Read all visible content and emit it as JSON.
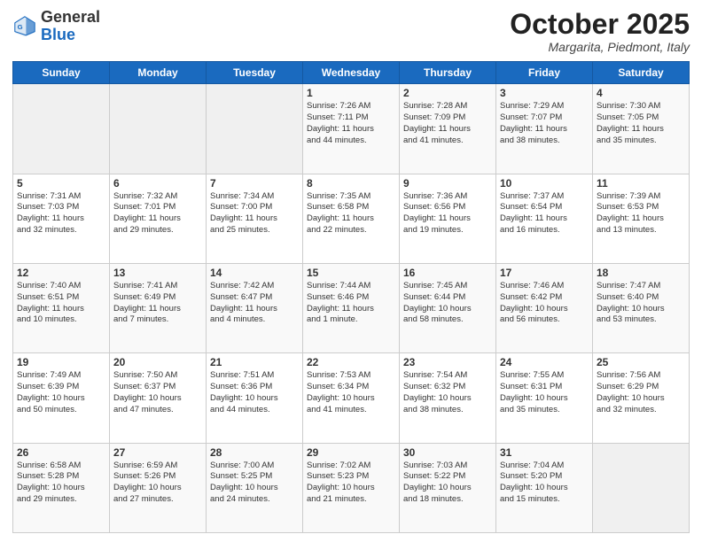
{
  "header": {
    "logo_general": "General",
    "logo_blue": "Blue",
    "month_title": "October 2025",
    "location": "Margarita, Piedmont, Italy"
  },
  "days_of_week": [
    "Sunday",
    "Monday",
    "Tuesday",
    "Wednesday",
    "Thursday",
    "Friday",
    "Saturday"
  ],
  "weeks": [
    [
      {
        "day": "",
        "info": ""
      },
      {
        "day": "",
        "info": ""
      },
      {
        "day": "",
        "info": ""
      },
      {
        "day": "1",
        "info": "Sunrise: 7:26 AM\nSunset: 7:11 PM\nDaylight: 11 hours\nand 44 minutes."
      },
      {
        "day": "2",
        "info": "Sunrise: 7:28 AM\nSunset: 7:09 PM\nDaylight: 11 hours\nand 41 minutes."
      },
      {
        "day": "3",
        "info": "Sunrise: 7:29 AM\nSunset: 7:07 PM\nDaylight: 11 hours\nand 38 minutes."
      },
      {
        "day": "4",
        "info": "Sunrise: 7:30 AM\nSunset: 7:05 PM\nDaylight: 11 hours\nand 35 minutes."
      }
    ],
    [
      {
        "day": "5",
        "info": "Sunrise: 7:31 AM\nSunset: 7:03 PM\nDaylight: 11 hours\nand 32 minutes."
      },
      {
        "day": "6",
        "info": "Sunrise: 7:32 AM\nSunset: 7:01 PM\nDaylight: 11 hours\nand 29 minutes."
      },
      {
        "day": "7",
        "info": "Sunrise: 7:34 AM\nSunset: 7:00 PM\nDaylight: 11 hours\nand 25 minutes."
      },
      {
        "day": "8",
        "info": "Sunrise: 7:35 AM\nSunset: 6:58 PM\nDaylight: 11 hours\nand 22 minutes."
      },
      {
        "day": "9",
        "info": "Sunrise: 7:36 AM\nSunset: 6:56 PM\nDaylight: 11 hours\nand 19 minutes."
      },
      {
        "day": "10",
        "info": "Sunrise: 7:37 AM\nSunset: 6:54 PM\nDaylight: 11 hours\nand 16 minutes."
      },
      {
        "day": "11",
        "info": "Sunrise: 7:39 AM\nSunset: 6:53 PM\nDaylight: 11 hours\nand 13 minutes."
      }
    ],
    [
      {
        "day": "12",
        "info": "Sunrise: 7:40 AM\nSunset: 6:51 PM\nDaylight: 11 hours\nand 10 minutes."
      },
      {
        "day": "13",
        "info": "Sunrise: 7:41 AM\nSunset: 6:49 PM\nDaylight: 11 hours\nand 7 minutes."
      },
      {
        "day": "14",
        "info": "Sunrise: 7:42 AM\nSunset: 6:47 PM\nDaylight: 11 hours\nand 4 minutes."
      },
      {
        "day": "15",
        "info": "Sunrise: 7:44 AM\nSunset: 6:46 PM\nDaylight: 11 hours\nand 1 minute."
      },
      {
        "day": "16",
        "info": "Sunrise: 7:45 AM\nSunset: 6:44 PM\nDaylight: 10 hours\nand 58 minutes."
      },
      {
        "day": "17",
        "info": "Sunrise: 7:46 AM\nSunset: 6:42 PM\nDaylight: 10 hours\nand 56 minutes."
      },
      {
        "day": "18",
        "info": "Sunrise: 7:47 AM\nSunset: 6:40 PM\nDaylight: 10 hours\nand 53 minutes."
      }
    ],
    [
      {
        "day": "19",
        "info": "Sunrise: 7:49 AM\nSunset: 6:39 PM\nDaylight: 10 hours\nand 50 minutes."
      },
      {
        "day": "20",
        "info": "Sunrise: 7:50 AM\nSunset: 6:37 PM\nDaylight: 10 hours\nand 47 minutes."
      },
      {
        "day": "21",
        "info": "Sunrise: 7:51 AM\nSunset: 6:36 PM\nDaylight: 10 hours\nand 44 minutes."
      },
      {
        "day": "22",
        "info": "Sunrise: 7:53 AM\nSunset: 6:34 PM\nDaylight: 10 hours\nand 41 minutes."
      },
      {
        "day": "23",
        "info": "Sunrise: 7:54 AM\nSunset: 6:32 PM\nDaylight: 10 hours\nand 38 minutes."
      },
      {
        "day": "24",
        "info": "Sunrise: 7:55 AM\nSunset: 6:31 PM\nDaylight: 10 hours\nand 35 minutes."
      },
      {
        "day": "25",
        "info": "Sunrise: 7:56 AM\nSunset: 6:29 PM\nDaylight: 10 hours\nand 32 minutes."
      }
    ],
    [
      {
        "day": "26",
        "info": "Sunrise: 6:58 AM\nSunset: 5:28 PM\nDaylight: 10 hours\nand 29 minutes."
      },
      {
        "day": "27",
        "info": "Sunrise: 6:59 AM\nSunset: 5:26 PM\nDaylight: 10 hours\nand 27 minutes."
      },
      {
        "day": "28",
        "info": "Sunrise: 7:00 AM\nSunset: 5:25 PM\nDaylight: 10 hours\nand 24 minutes."
      },
      {
        "day": "29",
        "info": "Sunrise: 7:02 AM\nSunset: 5:23 PM\nDaylight: 10 hours\nand 21 minutes."
      },
      {
        "day": "30",
        "info": "Sunrise: 7:03 AM\nSunset: 5:22 PM\nDaylight: 10 hours\nand 18 minutes."
      },
      {
        "day": "31",
        "info": "Sunrise: 7:04 AM\nSunset: 5:20 PM\nDaylight: 10 hours\nand 15 minutes."
      },
      {
        "day": "",
        "info": ""
      }
    ]
  ]
}
